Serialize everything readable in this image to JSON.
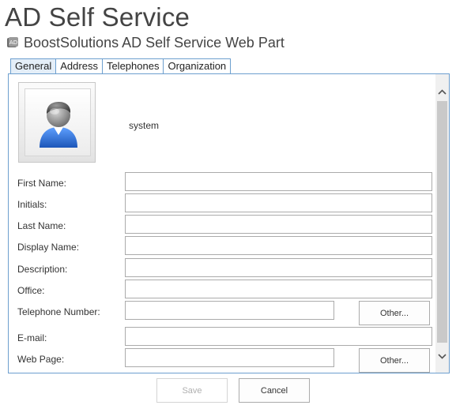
{
  "app": {
    "title": "AD Self Service"
  },
  "webpart": {
    "title": "BoostSolutions AD Self Service Web Part",
    "icon": "ad-webpart-icon"
  },
  "tabs": [
    {
      "label": "General",
      "active": true
    },
    {
      "label": "Address",
      "active": false
    },
    {
      "label": "Telephones",
      "active": false
    },
    {
      "label": "Organization",
      "active": false
    }
  ],
  "profile": {
    "user_name": "system",
    "avatar_icon": "user-avatar-icon"
  },
  "fields": {
    "first_name": {
      "label": "First Name:",
      "value": ""
    },
    "initials": {
      "label": "Initials:",
      "value": ""
    },
    "last_name": {
      "label": "Last Name:",
      "value": ""
    },
    "display_name": {
      "label": "Display Name:",
      "value": ""
    },
    "description": {
      "label": "Description:",
      "value": ""
    },
    "office": {
      "label": "Office:",
      "value": ""
    },
    "telephone_number": {
      "label": "Telephone Number:",
      "value": "",
      "other_label": "Other..."
    },
    "email": {
      "label": "E-mail:",
      "value": ""
    },
    "web_page": {
      "label": "Web Page:",
      "value": "",
      "other_label": "Other..."
    }
  },
  "actions": {
    "save_label": "Save",
    "cancel_label": "Cancel",
    "save_enabled": false
  },
  "colors": {
    "tab_border": "#6d9fcf",
    "active_tab_bg": "#e4eef8",
    "avatar_blue": "#2f6fd0"
  }
}
